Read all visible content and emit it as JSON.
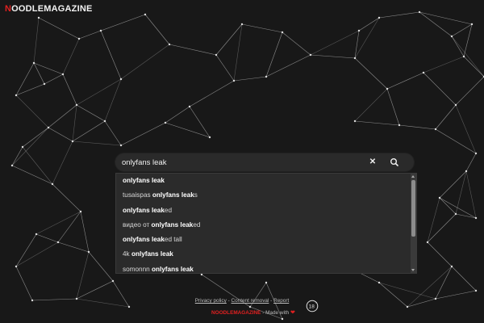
{
  "header": {
    "logo_first": "N",
    "logo_rest": "OODLEMAGAZINE"
  },
  "search": {
    "value": "onlyfans leak",
    "clear_label": "✕"
  },
  "suggestions": [
    {
      "prefix": "",
      "bold": "onlyfans leak",
      "suffix": ""
    },
    {
      "prefix": "tusaispas ",
      "bold": "onlyfans leak",
      "suffix": "s"
    },
    {
      "prefix": "",
      "bold": "onlyfans leak",
      "suffix": "ed"
    },
    {
      "prefix": "видео от ",
      "bold": "onlyfans leak",
      "suffix": "ed"
    },
    {
      "prefix": "",
      "bold": "onlyfans leak",
      "suffix": "ed tall"
    },
    {
      "prefix": "4k ",
      "bold": "onlyfans leak",
      "suffix": ""
    },
    {
      "prefix": "somonnn ",
      "bold": "onlyfans leak",
      "suffix": ""
    }
  ],
  "footer": {
    "privacy": "Privacy policy",
    "sep1": " - ",
    "content_removal": "Content removal",
    "sep2": " - ",
    "report": "Report",
    "brand": "NOODLEMAGAZINE",
    "made_with": " - Made with ",
    "heart": "❤",
    "age": "18"
  },
  "colors": {
    "background": "#181818",
    "accent": "#e02020",
    "search_bar": "#2a2a2a",
    "dropdown": "#2b2b2b"
  }
}
